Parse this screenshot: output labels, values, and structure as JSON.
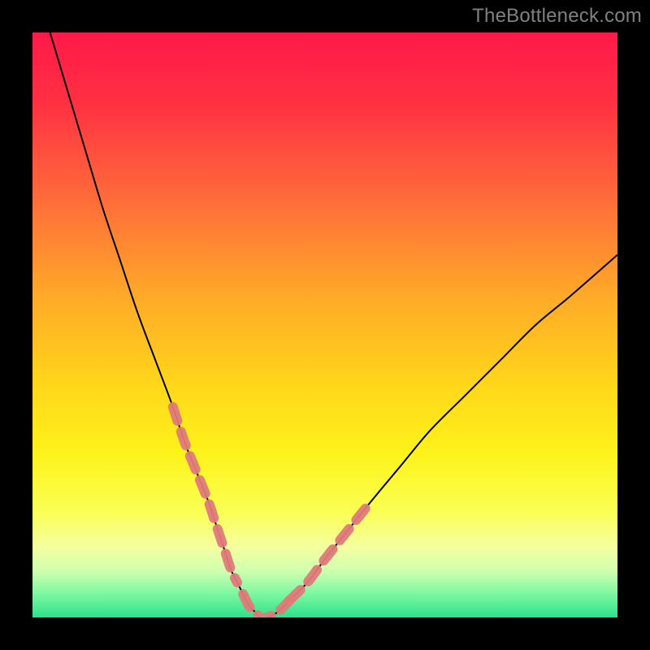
{
  "watermark": {
    "text": "TheBottleneck.com"
  },
  "gradient": {
    "stops": [
      {
        "offset": 0.0,
        "color": "#ff1a49"
      },
      {
        "offset": 0.12,
        "color": "#ff3042"
      },
      {
        "offset": 0.28,
        "color": "#ff6a3a"
      },
      {
        "offset": 0.45,
        "color": "#ffa928"
      },
      {
        "offset": 0.6,
        "color": "#ffd61a"
      },
      {
        "offset": 0.72,
        "color": "#fdf31a"
      },
      {
        "offset": 0.82,
        "color": "#faff55"
      },
      {
        "offset": 0.88,
        "color": "#f4ffa0"
      },
      {
        "offset": 0.92,
        "color": "#d0ffb0"
      },
      {
        "offset": 0.96,
        "color": "#7cf7a0"
      },
      {
        "offset": 1.0,
        "color": "#2ce28b"
      }
    ]
  },
  "curve_style": {
    "black": {
      "stroke": "#000000",
      "width": 2
    },
    "highlight": {
      "stroke": "#e07a7a",
      "width": 12,
      "opacity": 0.95,
      "linecap": "round",
      "dasharray": "18 14"
    }
  },
  "chart_data": {
    "type": "line",
    "title": "",
    "xlabel": "",
    "ylabel": "",
    "xlim": [
      0,
      100
    ],
    "ylim": [
      0,
      100
    ],
    "grid": false,
    "legend": false,
    "series": [
      {
        "name": "bottleneck-curve",
        "style": "black",
        "x": [
          3,
          6,
          9,
          12,
          15,
          18,
          21,
          24,
          26,
          28,
          30,
          31,
          32,
          33,
          34,
          35,
          36,
          37,
          38,
          39,
          40,
          42,
          44,
          47,
          50,
          54,
          58,
          63,
          68,
          74,
          80,
          86,
          92,
          100
        ],
        "y": [
          100,
          90,
          80,
          70,
          61,
          52,
          44,
          36,
          30,
          25,
          20,
          17,
          14,
          11,
          8,
          6,
          4,
          2,
          1,
          0,
          0,
          1,
          3,
          6,
          10,
          15,
          20,
          26,
          32,
          38,
          44,
          50,
          55,
          62
        ]
      },
      {
        "name": "highlight-left",
        "style": "highlight",
        "x": [
          24,
          26,
          28,
          30,
          31,
          32,
          33,
          34,
          35
        ],
        "y": [
          36,
          30,
          25,
          20,
          17,
          14,
          11,
          8,
          6
        ]
      },
      {
        "name": "highlight-bottom",
        "style": "highlight",
        "x": [
          36,
          37,
          38,
          39,
          40,
          42,
          44
        ],
        "y": [
          4,
          2,
          1,
          0,
          0,
          1,
          3
        ]
      },
      {
        "name": "highlight-right",
        "style": "highlight",
        "x": [
          44,
          47,
          50,
          54,
          58
        ],
        "y": [
          3,
          6,
          10,
          15,
          20
        ]
      }
    ]
  }
}
